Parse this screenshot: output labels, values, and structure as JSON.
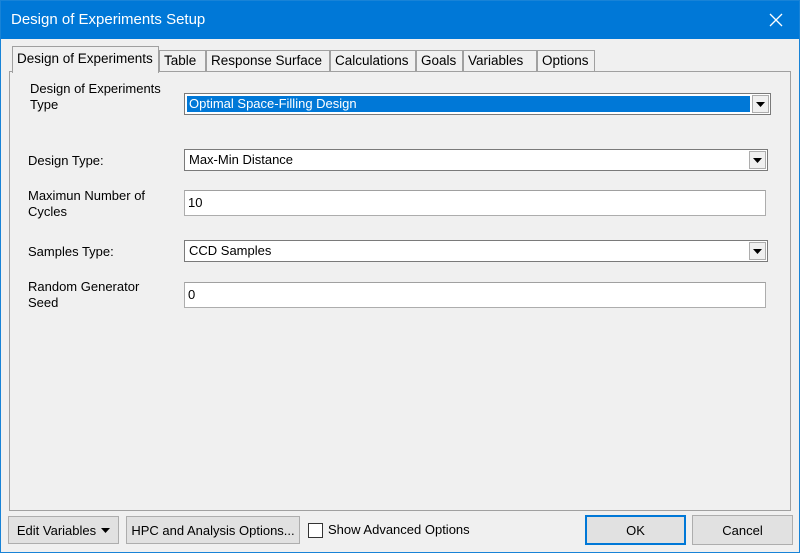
{
  "window": {
    "title": "Design of Experiments Setup"
  },
  "tabs": [
    {
      "label": "Design of Experiments",
      "active": true
    },
    {
      "label": "Table"
    },
    {
      "label": "Response Surface"
    },
    {
      "label": "Calculations"
    },
    {
      "label": "Goals"
    },
    {
      "label": "Variables"
    },
    {
      "label": "Options"
    }
  ],
  "form": {
    "doe_type": {
      "label_line1": "Design of Experiments",
      "label_line2": "Type",
      "value": "Optimal Space-Filling Design"
    },
    "design_type": {
      "label": "Design Type:",
      "value": "Max-Min Distance"
    },
    "max_cycles": {
      "label_line1": "Maximun Number of",
      "label_line2": "Cycles",
      "value": "10"
    },
    "samples_type": {
      "label": "Samples Type:",
      "value": "CCD Samples"
    },
    "seed": {
      "label_line1": "Random Generator",
      "label_line2": "Seed",
      "value": "0"
    }
  },
  "footer": {
    "edit_variables": "Edit Variables",
    "hpc_options": "HPC and Analysis Options...",
    "show_advanced": {
      "label": "Show Advanced Options",
      "checked": false
    },
    "ok": "OK",
    "cancel": "Cancel"
  }
}
